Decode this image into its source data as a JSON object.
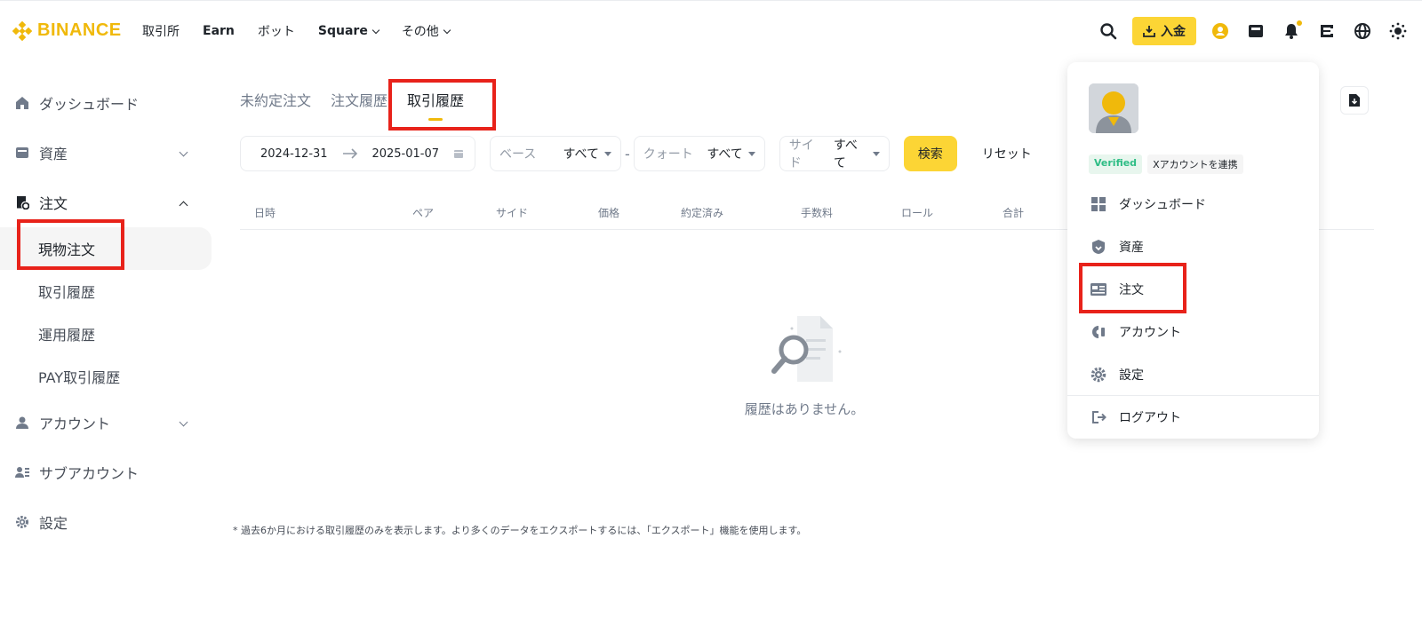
{
  "brand": {
    "name": "BINANCE",
    "color": "#F0B90B"
  },
  "nav": {
    "items": [
      {
        "label": "取引所"
      },
      {
        "label": "Earn"
      },
      {
        "label": "ボット"
      },
      {
        "label": "Square"
      },
      {
        "label": "その他"
      }
    ]
  },
  "header": {
    "deposit_label": "入金",
    "icons": [
      "search-icon",
      "deposit-icon",
      "user-icon",
      "wallet-icon",
      "bell-icon",
      "qr-icon",
      "globe-icon",
      "theme-icon"
    ]
  },
  "sidebar": {
    "items": [
      {
        "label": "ダッシュボード",
        "icon": "home-icon"
      },
      {
        "label": "資産",
        "icon": "wallet-icon"
      },
      {
        "label": "注文",
        "icon": "order-icon"
      },
      {
        "label": "アカウント",
        "icon": "user-icon"
      },
      {
        "label": "サブアカウント",
        "icon": "sub-account-icon"
      },
      {
        "label": "設定",
        "icon": "gear-icon"
      }
    ],
    "sub_items": [
      {
        "label": "現物注文"
      },
      {
        "label": "取引履歴"
      },
      {
        "label": "運用履歴"
      },
      {
        "label": "PAY取引履歴"
      }
    ]
  },
  "tabs": [
    {
      "label": "未約定注文"
    },
    {
      "label": "注文履歴"
    },
    {
      "label": "取引履歴"
    }
  ],
  "filters": {
    "date_from": "2024-12-31",
    "date_to": "2025-01-07",
    "base_label": "ベース",
    "base_value": "すべて",
    "quote_label": "クォート",
    "quote_value": "すべて",
    "side_label": "サイド",
    "side_value": "すべて",
    "search_label": "検索",
    "reset_label": "リセット"
  },
  "table": {
    "columns": [
      "日時",
      "ペア",
      "サイド",
      "価格",
      "約定済み",
      "手数料",
      "ロール",
      "合計"
    ]
  },
  "empty_state": {
    "text": "履歴はありません。"
  },
  "footnote": "* 過去6か月における取引履歴のみを表示します。より多くのデータをエクスポートするには、「エクスポート」機能を使用します。",
  "dropdown": {
    "verified_label": "Verified",
    "x_link_label": "Xアカウントを連携",
    "items": [
      {
        "label": "ダッシュボード",
        "icon": "dashboard-icon"
      },
      {
        "label": "資産",
        "icon": "shield-icon"
      },
      {
        "label": "注文",
        "icon": "order-list-icon"
      },
      {
        "label": "アカウント",
        "icon": "account-icon"
      },
      {
        "label": "設定",
        "icon": "gear-icon"
      },
      {
        "label": "ログアウト",
        "icon": "logout-icon"
      }
    ]
  },
  "colors": {
    "accent": "#FCD535",
    "highlight": "#E8221A",
    "verified": "#2EBD85"
  }
}
